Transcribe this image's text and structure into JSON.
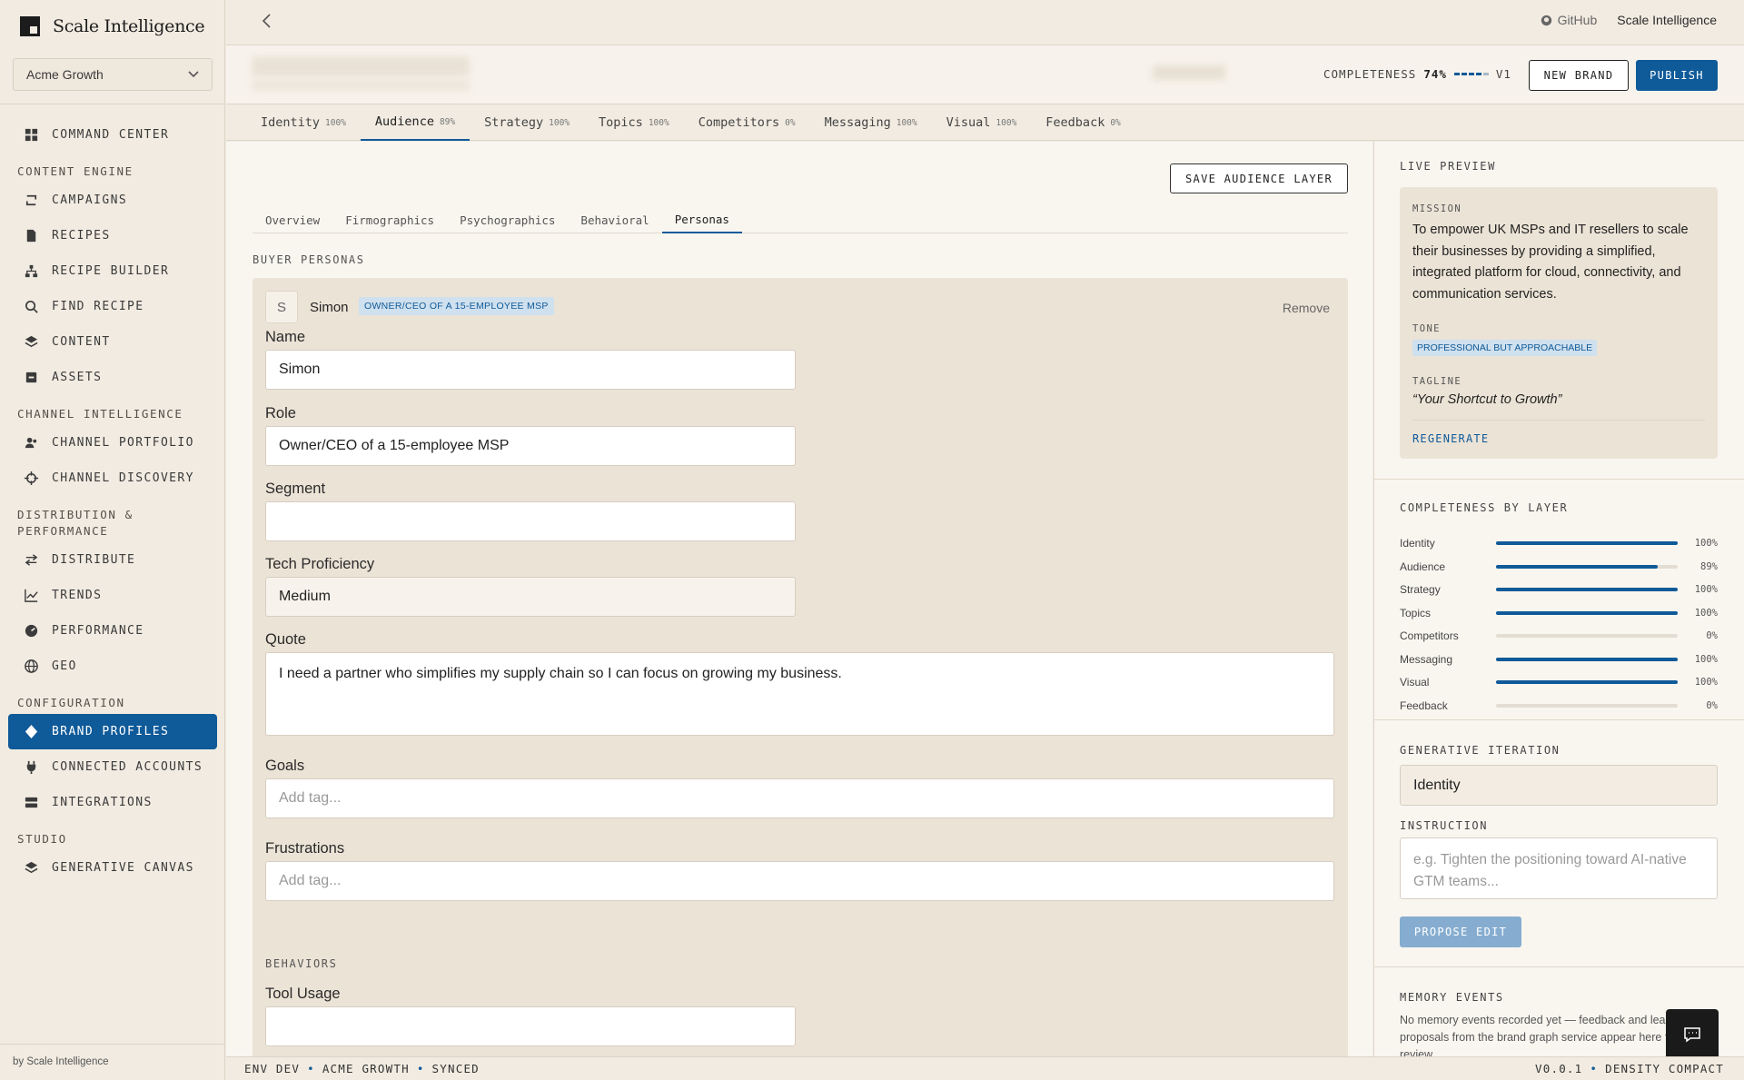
{
  "app": {
    "logo_text": "Scale Intelligence",
    "workspace": "Acme Growth",
    "footer": "by Scale Intelligence"
  },
  "sidebar": {
    "items": [
      {
        "label": "COMMAND CENTER",
        "icon": "grid-icon"
      },
      {
        "section": "CONTENT ENGINE"
      },
      {
        "label": "CAMPAIGNS",
        "icon": "loop-icon"
      },
      {
        "label": "RECIPES",
        "icon": "document-icon"
      },
      {
        "label": "RECIPE BUILDER",
        "icon": "hierarchy-icon"
      },
      {
        "label": "FIND RECIPE",
        "icon": "search-icon"
      },
      {
        "label": "CONTENT",
        "icon": "layers-icon"
      },
      {
        "label": "ASSETS",
        "icon": "archive-icon"
      },
      {
        "section": "CHANNEL INTELLIGENCE"
      },
      {
        "label": "CHANNEL PORTFOLIO",
        "icon": "users-icon"
      },
      {
        "label": "CHANNEL DISCOVERY",
        "icon": "crosshair-icon"
      },
      {
        "section": "DISTRIBUTION &\nPERFORMANCE"
      },
      {
        "label": "DISTRIBUTE",
        "icon": "arrows-icon"
      },
      {
        "label": "TRENDS",
        "icon": "chart-line-icon"
      },
      {
        "label": "PERFORMANCE",
        "icon": "gauge-icon"
      },
      {
        "label": "GEO",
        "icon": "globe-icon"
      },
      {
        "section": "CONFIGURATION"
      },
      {
        "label": "BRAND PROFILES",
        "icon": "diamond-icon",
        "active": true
      },
      {
        "label": "CONNECTED ACCOUNTS",
        "icon": "plug-icon"
      },
      {
        "label": "INTEGRATIONS",
        "icon": "server-icon"
      },
      {
        "section": "STUDIO"
      },
      {
        "label": "GENERATIVE CANVAS",
        "icon": "layers-icon"
      }
    ]
  },
  "topbar": {
    "github": "GitHub",
    "org": "Scale Intelligence"
  },
  "brandbar": {
    "completeness_label": "COMPLETENESS",
    "completeness_value": "74%",
    "completeness": 0.74,
    "version": "V1",
    "new_brand": "NEW BRAND",
    "publish": "PUBLISH"
  },
  "tabs": [
    {
      "label": "Identity",
      "pct": "100%"
    },
    {
      "label": "Audience",
      "pct": "89%",
      "active": true
    },
    {
      "label": "Strategy",
      "pct": "100%"
    },
    {
      "label": "Topics",
      "pct": "100%"
    },
    {
      "label": "Competitors",
      "pct": "0%"
    },
    {
      "label": "Messaging",
      "pct": "100%"
    },
    {
      "label": "Visual",
      "pct": "100%"
    },
    {
      "label": "Feedback",
      "pct": "0%"
    }
  ],
  "main": {
    "save_label": "SAVE AUDIENCE LAYER",
    "subtabs": [
      "Overview",
      "Firmographics",
      "Psychographics",
      "Behavioral",
      "Personas"
    ],
    "active_subtab": 4,
    "section_title": "BUYER PERSONAS",
    "persona": {
      "initial": "S",
      "name": "Simon",
      "badge": "OWNER/CEO OF A 15-EMPLOYEE MSP",
      "remove": "Remove",
      "fields": {
        "name_label": "Name",
        "name_value": "Simon",
        "role_label": "Role",
        "role_value": "Owner/CEO of a 15-employee MSP",
        "segment_label": "Segment",
        "segment_value": "",
        "tech_label": "Tech Proficiency",
        "tech_value": "Medium",
        "quote_label": "Quote",
        "quote_value": "I need a partner who simplifies my supply chain so I can focus on growing my business.",
        "goals_label": "Goals",
        "goals_placeholder": "Add tag...",
        "frustrations_label": "Frustrations",
        "frustrations_placeholder": "Add tag...",
        "behaviors_title": "BEHAVIORS",
        "tool_label": "Tool Usage",
        "tool_value": ""
      }
    }
  },
  "right": {
    "live_preview": "LIVE PREVIEW",
    "mission_label": "MISSION",
    "mission": "To empower UK MSPs and IT resellers to scale their businesses by providing a simplified, integrated platform for cloud, connectivity, and communication services.",
    "tone_label": "TONE",
    "tone": "PROFESSIONAL BUT APPROACHABLE",
    "tagline_label": "TAGLINE",
    "tagline": "“Your Shortcut to Growth”",
    "regenerate": "REGENERATE",
    "completeness_title": "COMPLETENESS BY LAYER",
    "layers": [
      {
        "name": "Identity",
        "pct": "100%",
        "value": 100
      },
      {
        "name": "Audience",
        "pct": "89%",
        "value": 89
      },
      {
        "name": "Strategy",
        "pct": "100%",
        "value": 100
      },
      {
        "name": "Topics",
        "pct": "100%",
        "value": 100
      },
      {
        "name": "Competitors",
        "pct": "0%",
        "value": 0
      },
      {
        "name": "Messaging",
        "pct": "100%",
        "value": 100
      },
      {
        "name": "Visual",
        "pct": "100%",
        "value": 100
      },
      {
        "name": "Feedback",
        "pct": "0%",
        "value": 0
      }
    ],
    "gen_title": "GENERATIVE ITERATION",
    "gen_layer": "Identity",
    "instruction_label": "INSTRUCTION",
    "instruction_placeholder": "e.g. Tighten the positioning toward AI-native GTM teams...",
    "propose": "PROPOSE EDIT",
    "memory_title": "MEMORY EVENTS",
    "memory_text": "No memory events recorded yet — feedback and learning proposals from the brand graph service appear here for review."
  },
  "status": {
    "env": "ENV DEV",
    "workspace": "ACME GROWTH",
    "sync": "SYNCED",
    "version": "V0.0.1",
    "density": "DENSITY COMPACT"
  },
  "colors": {
    "accent": "#0f5a99",
    "bg": "#f1ebe1",
    "panel": "#ebe3d6"
  }
}
